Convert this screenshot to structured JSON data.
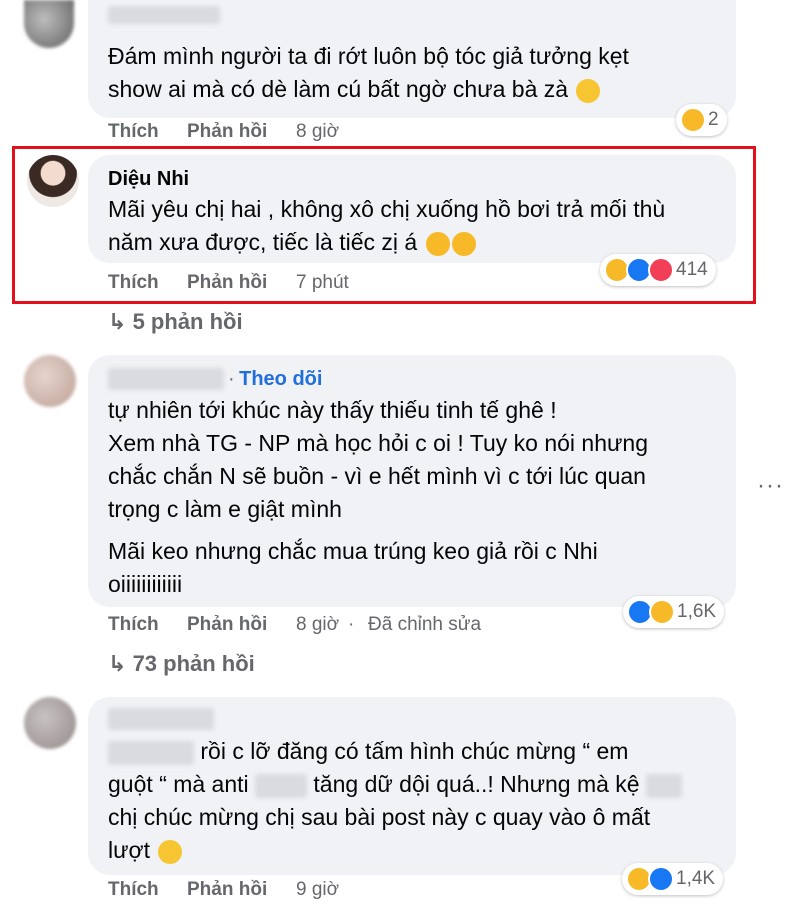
{
  "comments": [
    {
      "text_lines": [
        "Đám mình người ta đi rớt luôn bộ tóc giả tưởng kẹt",
        "show ai mà có dè làm cú bất ngờ chưa bà zà"
      ],
      "like_label": "Thích",
      "reply_label": "Phản hồi",
      "time": "8 giờ",
      "reaction_count": "2"
    },
    {
      "author": "Diệu Nhi",
      "text_lines": [
        "Mãi yêu chị hai , không xô chị xuống hồ bơi trả mối thù",
        "năm xưa được, tiếc là tiếc zị á"
      ],
      "like_label": "Thích",
      "reply_label": "Phản hồi",
      "time": "7 phút",
      "reaction_count": "414",
      "replies_label": "5 phản hồi"
    },
    {
      "follow_label": "Theo dõi",
      "text_lines": [
        "tự nhiên tới khúc này thấy thiếu tinh tế ghê !",
        "Xem nhà TG - NP mà học hỏi c oi ! Tuy ko nói nhưng",
        "chắc chắn N sẽ buồn - vì e hết mình vì c tới lúc quan",
        "trọng c làm e giật mình"
      ],
      "text_lines_2": [
        "Mãi keo nhưng chắc mua trúng keo giả rồi c Nhi",
        "oiiiiiiiiiiii"
      ],
      "like_label": "Thích",
      "reply_label": "Phản hồi",
      "time": "8 giờ",
      "edited_label": "Đã chỉnh sửa",
      "reaction_count": "1,6K",
      "replies_label": "73 phản hồi",
      "more_icon": "···"
    },
    {
      "text_line1_part": "rồi c lỡ đăng có tấm hình chúc mừng “ em",
      "text_line2_a": "guột “ mà anti",
      "text_line2_b": "tăng dữ dội quá..! Nhưng mà kệ",
      "text_line3": "chị chúc mừng chị sau bài post này c quay vào ô mất",
      "text_line4": "lượt",
      "like_label": "Thích",
      "reply_label": "Phản hồi",
      "time": "9 giờ",
      "reaction_count": "1,4K"
    }
  ],
  "colors": {
    "highlight": "#e3101b",
    "bubble": "#f0f2f5",
    "link": "#216fdb",
    "meta": "#65676b"
  }
}
